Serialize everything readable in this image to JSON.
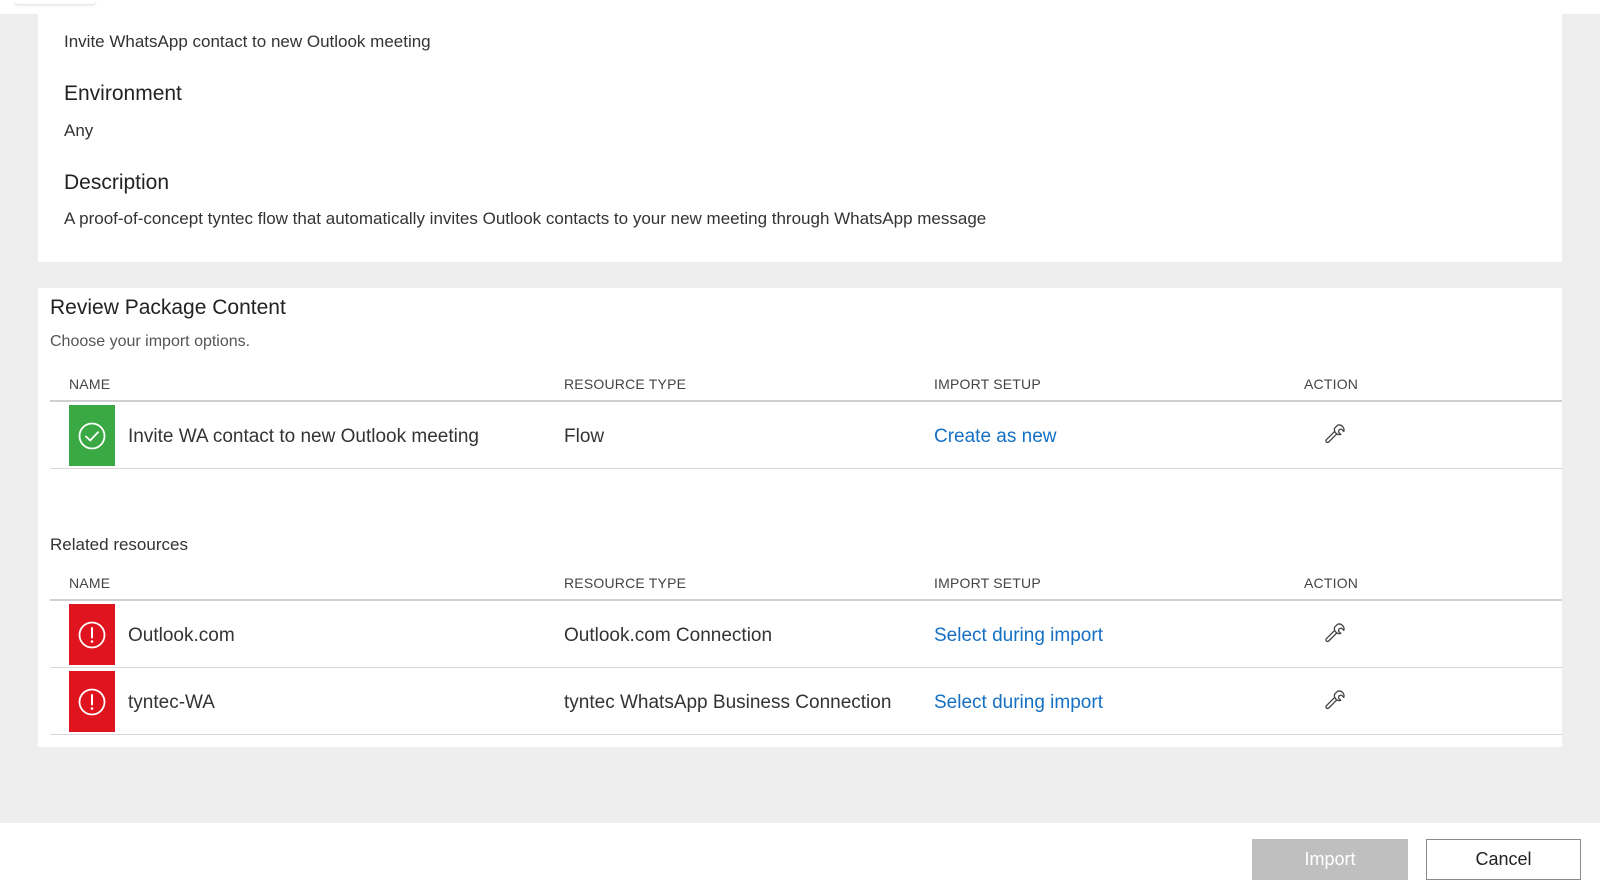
{
  "details": {
    "flow_name": "Invite WhatsApp contact to new Outlook meeting",
    "environment_label": "Environment",
    "environment_value": "Any",
    "description_label": "Description",
    "description_value": "A proof-of-concept tyntec flow that automatically invites Outlook contacts to your new meeting through WhatsApp message"
  },
  "review": {
    "title": "Review Package Content",
    "subtitle": "Choose your import options.",
    "columns": [
      "NAME",
      "RESOURCE TYPE",
      "IMPORT SETUP",
      "ACTION"
    ],
    "rows": [
      {
        "status": "ok",
        "status_icon": "check-circle-icon",
        "name": "Invite WA contact to new Outlook meeting",
        "type": "Flow",
        "setup": "Create as new",
        "action_icon": "wrench-icon"
      }
    ]
  },
  "related": {
    "title": "Related resources",
    "columns": [
      "NAME",
      "RESOURCE TYPE",
      "IMPORT SETUP",
      "ACTION"
    ],
    "rows": [
      {
        "status": "error",
        "status_icon": "error-circle-icon",
        "name": "Outlook.com",
        "type": "Outlook.com Connection",
        "setup": "Select during import",
        "action_icon": "wrench-icon"
      },
      {
        "status": "error",
        "status_icon": "error-circle-icon",
        "name": "tyntec-WA",
        "type": "tyntec WhatsApp Business Connection",
        "setup": "Select during import",
        "action_icon": "wrench-icon"
      }
    ]
  },
  "footer": {
    "import_label": "Import",
    "cancel_label": "Cancel"
  },
  "colors": {
    "ok": "#3aa843",
    "error": "#e0141e",
    "link": "#1570c4",
    "disabled_button": "#bfbfbf"
  }
}
